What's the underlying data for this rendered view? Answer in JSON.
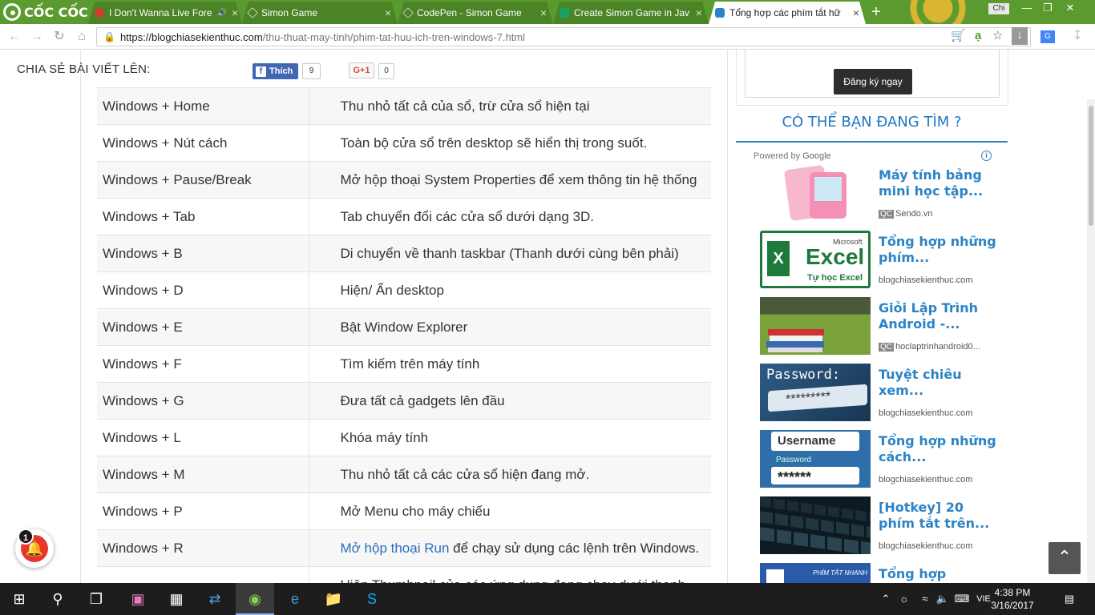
{
  "browser": {
    "brand": "CỐC CỐC",
    "profile": "Chi",
    "tabs": [
      {
        "title": "I Don't Wanna Live Fore",
        "fav_color": "#d23b2f"
      },
      {
        "title": "Simon Game",
        "fav_color": "#333333"
      },
      {
        "title": "CodePen - Simon Game",
        "fav_color": "#333333"
      },
      {
        "title": "Create Simon Game in Jav",
        "fav_color": "#1aa260"
      },
      {
        "title": "Tổng hợp các phím tắt hữ",
        "fav_color": "#2b84c6"
      }
    ],
    "url_host": "https://blogchiasekienthuc.com",
    "url_path": "/thu-thuat-may-tinh/phim-tat-huu-ich-tren-windows-7.html"
  },
  "share": {
    "label": "CHIA SẺ BÀI VIẾT LÊN:",
    "fb_label": "Thích",
    "fb_count": "9",
    "gplus_label": "G+1",
    "gplus_count": "0"
  },
  "shortcuts": [
    {
      "key": "Windows + Home",
      "desc": "Thu nhỏ tất cả của sổ, trừ cửa sổ hiện tại"
    },
    {
      "key": "Windows + Nút cách",
      "desc": "Toàn bộ cửa sổ trên desktop sẽ hiển thị trong suốt."
    },
    {
      "key": "Windows + Pause/Break",
      "desc": "Mở hộp thoại System Properties để xem thông tin hệ thống"
    },
    {
      "key": "Windows + Tab",
      "desc": "Tab chuyển đổi các cửa sổ dưới dạng 3D."
    },
    {
      "key": "Windows + B",
      "desc": "Di chuyển về thanh taskbar (Thanh dưới cùng bên phải)"
    },
    {
      "key": "Windows + D",
      "desc": "Hiện/ Ẩn desktop"
    },
    {
      "key": "Windows + E",
      "desc": "Bật Window Explorer"
    },
    {
      "key": "Windows + F",
      "desc": "Tìm kiếm trên máy tính"
    },
    {
      "key": "Windows + G",
      "desc": "Đưa tất cả gadgets lên đầu"
    },
    {
      "key": "Windows + L",
      "desc": "Khóa máy tính"
    },
    {
      "key": "Windows + M",
      "desc": "Thu nhỏ tất cả các cửa sổ hiện đang mở."
    },
    {
      "key": "Windows + P",
      "desc": "Mở Menu cho máy chiếu"
    },
    {
      "key": "Windows + R",
      "desc_link": "Mở hộp thoại Run",
      "desc_rest": " để chạy sử dụng các lệnh trên Windows."
    },
    {
      "key": "",
      "desc": "Hiện Thumbnail của các ứng dụng đang chạy dưới thanh"
    }
  ],
  "sidebar": {
    "register_button": "Đăng ký ngay",
    "heading": "CÓ THỂ BẠN ĐANG TÌM ?",
    "powered_by": "Powered by",
    "powered_brand": "Google",
    "info_label": "i",
    "items": [
      {
        "title": "Máy tính bảng mini học tập...",
        "source": "Sendo.vn",
        "qc": "QC"
      },
      {
        "title": "Tổng hợp những phím...",
        "source": "blogchiasekienthuc.com",
        "qc": ""
      },
      {
        "title": "Giỏi Lập Trình Android -...",
        "source": "hoclaptrinhandroid0...",
        "qc": "QC"
      },
      {
        "title": "Tuyệt chiêu xem...",
        "source": "blogchiasekienthuc.com",
        "qc": ""
      },
      {
        "title": "Tổng hợp những cách...",
        "source": "blogchiasekienthuc.com",
        "qc": ""
      },
      {
        "title": "[Hotkey] 20 phím tắt trên...",
        "source": "blogchiasekienthuc.com",
        "qc": ""
      },
      {
        "title": "Tổng hợp",
        "source": "",
        "qc": ""
      }
    ],
    "thumb_texts": {
      "excel_brand": "Microsoft",
      "excel_word": "Excel",
      "excel_caption": "Tự học Excel",
      "password_word": "Password:",
      "password_mask": "*********",
      "username_word": "Username",
      "username_pw": "Password",
      "username_mask": "******",
      "hotkey_caption": "PHÍM TẮT NHANH"
    }
  },
  "notification": {
    "count": "1"
  },
  "taskbar": {
    "lang": "VIE",
    "time": "4:38 PM",
    "date": "3/16/2017"
  }
}
